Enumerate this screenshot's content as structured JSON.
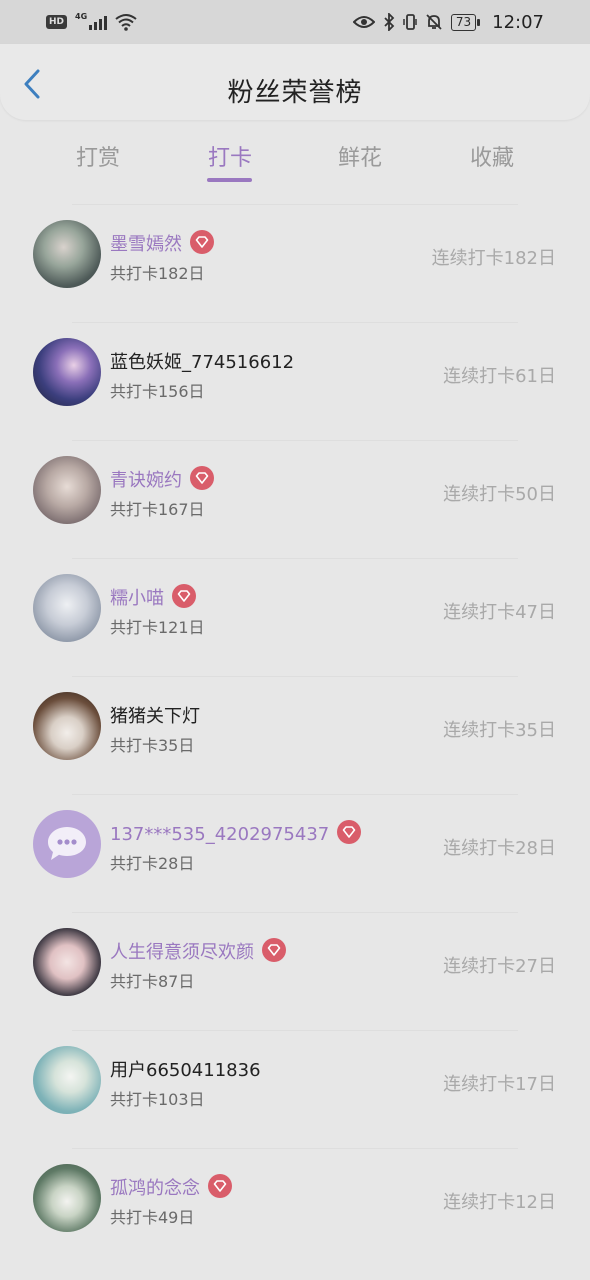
{
  "status_bar": {
    "hd": "HD",
    "network": "4G",
    "battery": "73",
    "time": "12:07"
  },
  "header": {
    "title": "粉丝荣誉榜"
  },
  "tabs": [
    {
      "label": "打赏",
      "active": false
    },
    {
      "label": "打卡",
      "active": true
    },
    {
      "label": "鲜花",
      "active": false
    },
    {
      "label": "收藏",
      "active": false
    }
  ],
  "fans": [
    {
      "name": "墨雪嫣然",
      "vip": true,
      "total": "共打卡182日",
      "streak": "连续打卡182日"
    },
    {
      "name": "蓝色妖姬_774516612",
      "vip": false,
      "total": "共打卡156日",
      "streak": "连续打卡61日"
    },
    {
      "name": "青诀婉约",
      "vip": true,
      "total": "共打卡167日",
      "streak": "连续打卡50日"
    },
    {
      "name": "糯小喵",
      "vip": true,
      "total": "共打卡121日",
      "streak": "连续打卡47日"
    },
    {
      "name": "猪猪关下灯",
      "vip": false,
      "total": "共打卡35日",
      "streak": "连续打卡35日"
    },
    {
      "name": "137***535_4202975437",
      "vip": true,
      "total": "共打卡28日",
      "streak": "连续打卡28日"
    },
    {
      "name": "人生得意须尽欢颜",
      "vip": true,
      "total": "共打卡87日",
      "streak": "连续打卡27日"
    },
    {
      "name": "用户6650411836",
      "vip": false,
      "total": "共打卡103日",
      "streak": "连续打卡17日"
    },
    {
      "name": "孤鸿的念念",
      "vip": true,
      "total": "共打卡49日",
      "streak": "连续打卡12日"
    }
  ],
  "colors": {
    "accent": "#9a78c0",
    "vip_badge": "#d95d6a",
    "back_arrow": "#3d7fbf",
    "overlay_gray": "#e7e7e7"
  }
}
